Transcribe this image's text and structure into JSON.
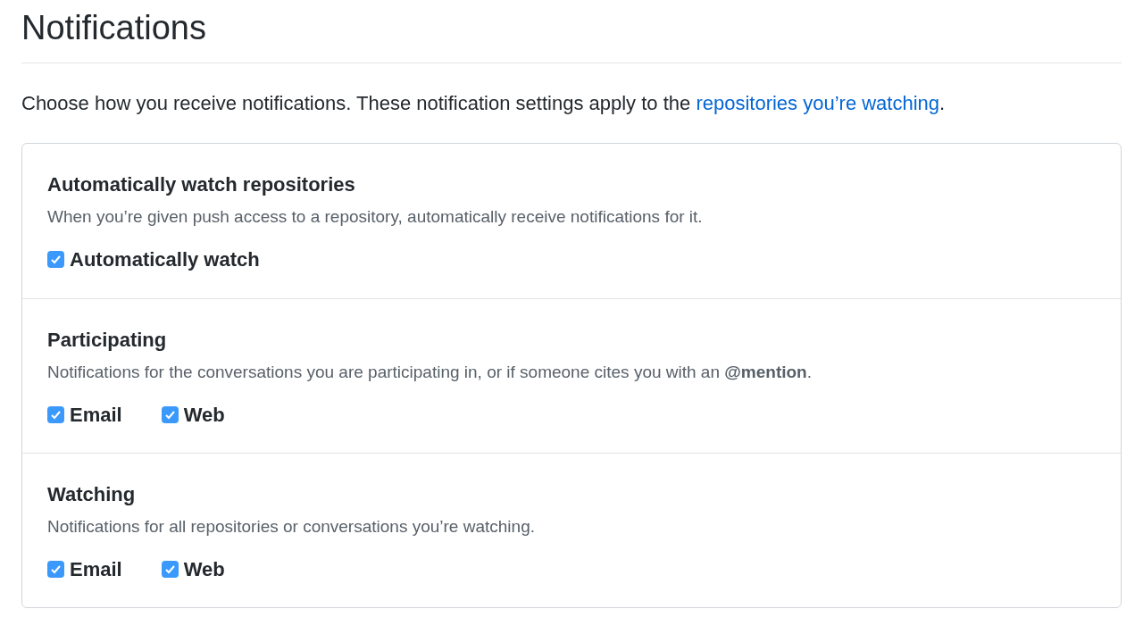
{
  "title": "Notifications",
  "intro": {
    "text": "Choose how you receive notifications. These notification settings apply to the ",
    "link": "repositories you’re watching",
    "end": "."
  },
  "sections": [
    {
      "heading": "Automatically watch repositories",
      "description": "When you’re given push access to a repository, automatically receive notifications for it.",
      "options": [
        {
          "label": "Automatically watch",
          "checked": true
        }
      ]
    },
    {
      "heading": "Participating",
      "description": "Notifications for the conversations you are participating in, or if someone cites you with an **@mention**.",
      "options": [
        {
          "label": "Email",
          "checked": true
        },
        {
          "label": "Web",
          "checked": true
        }
      ]
    },
    {
      "heading": "Watching",
      "description": "Notifications for all repositories or conversations you’re watching.",
      "options": [
        {
          "label": "Email",
          "checked": true
        },
        {
          "label": "Web",
          "checked": true
        }
      ]
    }
  ]
}
